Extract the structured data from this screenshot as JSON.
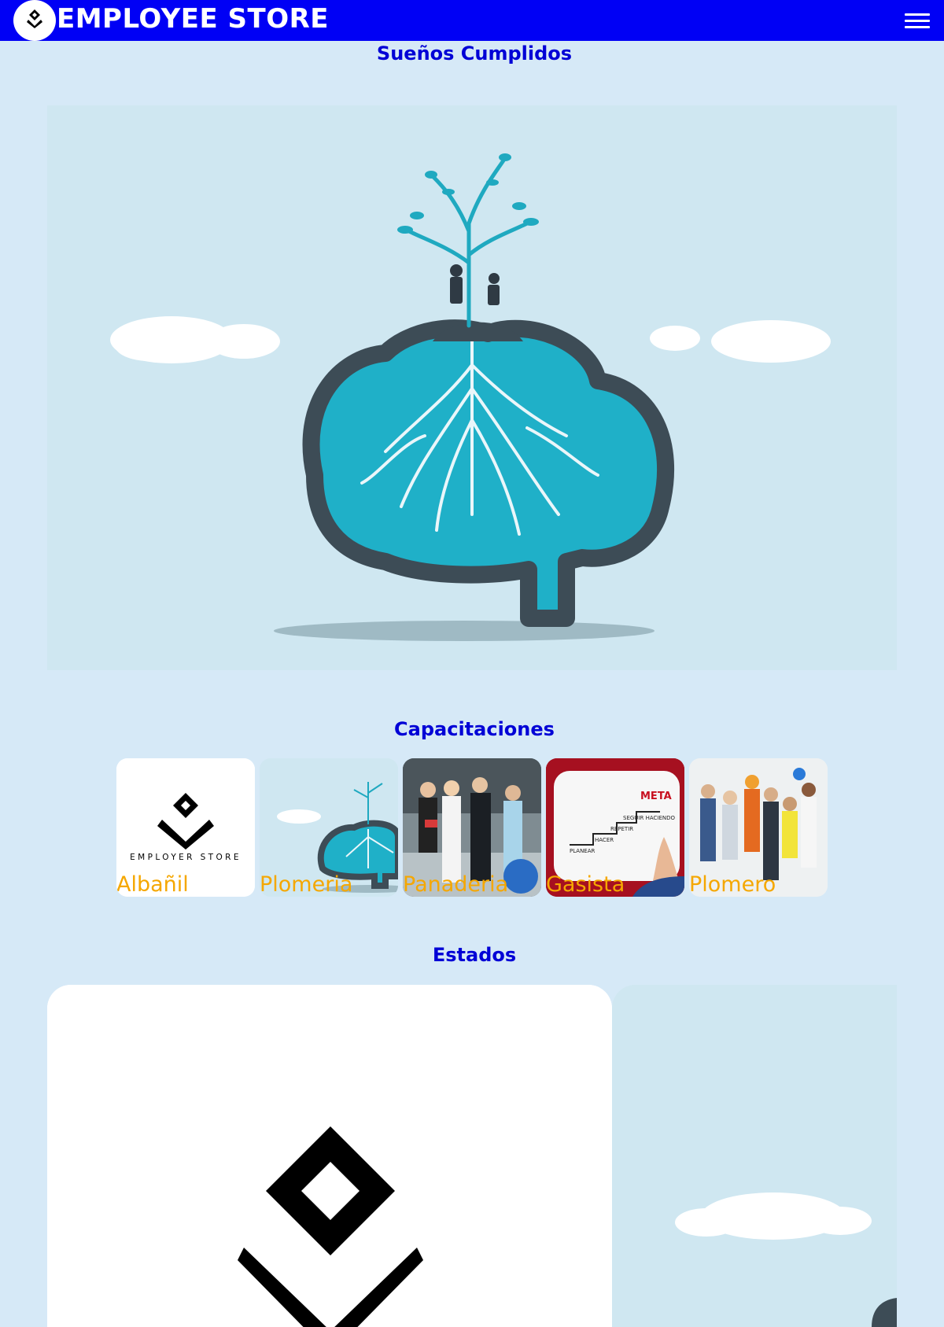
{
  "header": {
    "brand": "EMPLOYEE STORE",
    "logo_icon": "employee-store-logo-icon",
    "menu_icon": "hamburger-menu-icon",
    "background": "#0000f5"
  },
  "sections": {
    "dreams_title": "Sueños Cumplidos",
    "trainings_title": "Capacitaciones",
    "states_title": "Estados"
  },
  "trainings": [
    {
      "label": "Albañil",
      "image": "employer-store-logo"
    },
    {
      "label": "Plomeria",
      "image": "brain-tree-illustration"
    },
    {
      "label": "Panaderia",
      "image": "team-photo"
    },
    {
      "label": "Gasista",
      "image": "goal-whiteboard"
    },
    {
      "label": "Plomero",
      "image": "workers-group-photo"
    }
  ],
  "card_logo_caption": "EMPLOYER STORE",
  "colors": {
    "page_bg": "#d6e9f7",
    "title_blue": "#0000d6",
    "label_orange": "#f5a700"
  }
}
